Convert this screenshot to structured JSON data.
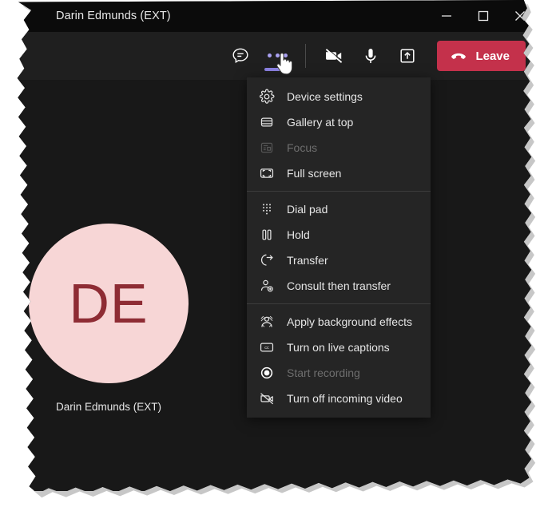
{
  "window": {
    "title": "Darin Edmunds (EXT)",
    "controls": [
      {
        "name": "minimize-button",
        "glyph": "minimize"
      },
      {
        "name": "maximize-button",
        "glyph": "maximize"
      },
      {
        "name": "close-button",
        "glyph": "close"
      }
    ]
  },
  "toolbar": {
    "chat_label": "Chat",
    "more_label": "More actions",
    "camera_label": "Turn camera on",
    "mic_label": "Mute",
    "share_label": "Share content",
    "leave_label": "Leave",
    "leave_color": "#c4314b",
    "more_accent_color": "#a9a0f0"
  },
  "stage": {
    "participant_name": "Darin Edmunds (EXT)",
    "avatar_initials": "DE",
    "avatar_bg_color": "#f7d6d6",
    "avatar_text_color": "#8e2c34",
    "background_color": "#181818"
  },
  "menu": {
    "groups": [
      {
        "items": [
          {
            "label": "Device settings",
            "icon": "gear-icon",
            "disabled": false
          },
          {
            "label": "Gallery at top",
            "icon": "gallery-icon",
            "disabled": false
          },
          {
            "label": "Focus",
            "icon": "focus-icon",
            "disabled": true
          },
          {
            "label": "Full screen",
            "icon": "fullscreen-icon",
            "disabled": false
          }
        ]
      },
      {
        "items": [
          {
            "label": "Dial pad",
            "icon": "dialpad-icon",
            "disabled": false
          },
          {
            "label": "Hold",
            "icon": "hold-icon",
            "disabled": false
          },
          {
            "label": "Transfer",
            "icon": "transfer-icon",
            "disabled": false
          },
          {
            "label": "Consult then transfer",
            "icon": "consult-transfer-icon",
            "disabled": false
          }
        ]
      },
      {
        "items": [
          {
            "label": "Apply background effects",
            "icon": "background-effects-icon",
            "disabled": false
          },
          {
            "label": "Turn on live captions",
            "icon": "closed-captions-icon",
            "disabled": false
          },
          {
            "label": "Start recording",
            "icon": "record-icon",
            "disabled": true,
            "bright_icon": true
          },
          {
            "label": "Turn off incoming video",
            "icon": "camera-off-icon",
            "disabled": false
          }
        ]
      }
    ]
  }
}
